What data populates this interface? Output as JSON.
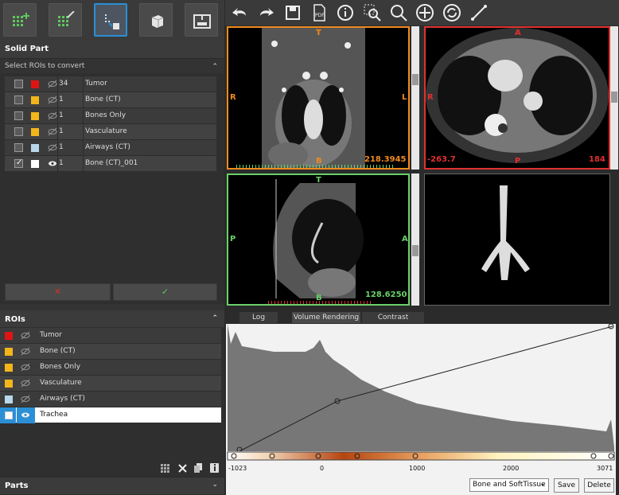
{
  "solid_part": {
    "title": "Solid Part",
    "subtitle": "Select ROIs to convert",
    "rows": [
      {
        "count": "34",
        "name": "Tumor",
        "color": "#e01414",
        "checked": false,
        "visible": false
      },
      {
        "count": "1",
        "name": "Bone (CT)",
        "color": "#f2b61b",
        "checked": false,
        "visible": false
      },
      {
        "count": "1",
        "name": "Bones Only",
        "color": "#f2b61b",
        "checked": false,
        "visible": false
      },
      {
        "count": "1",
        "name": "Vasculature",
        "color": "#f2b61b",
        "checked": false,
        "visible": false
      },
      {
        "count": "1",
        "name": "Airways (CT)",
        "color": "#b8d8ea",
        "checked": false,
        "visible": false
      },
      {
        "count": "1",
        "name": "Bone (CT)_001",
        "color": "#ffffff",
        "checked": true,
        "visible": true
      }
    ],
    "cancel_label": "✕",
    "ok_label": "✓"
  },
  "rois": {
    "title": "ROIs",
    "items": [
      {
        "name": "Tumor",
        "color": "#e01414"
      },
      {
        "name": "Bone (CT)",
        "color": "#f2b61b"
      },
      {
        "name": "Bones Only",
        "color": "#f2b61b"
      },
      {
        "name": "Vasculature",
        "color": "#f2b61b"
      },
      {
        "name": "Airways (CT)",
        "color": "#b8d8ea"
      },
      {
        "name": "Trachea",
        "color": "#ffffff",
        "selected": true
      }
    ]
  },
  "parts": {
    "title": "Parts"
  },
  "views": {
    "coronal": {
      "top": "T",
      "left": "R",
      "right": "L",
      "bottom": "B",
      "value": "218.3945"
    },
    "axial": {
      "top": "A",
      "left": "R",
      "value_left": "-263.7",
      "bottom": "P",
      "value_right": "184"
    },
    "sagittal": {
      "top": "T",
      "left": "P",
      "right": "A",
      "bottom": "B",
      "value": "128.6250"
    }
  },
  "tabs": [
    "Log",
    "Volume Rendering",
    "Contrast"
  ],
  "histogram": {
    "axis_labels": [
      "-1023",
      "0",
      "1000",
      "2000",
      "3071"
    ],
    "preset": "Bone and SoftTissue",
    "save_label": "Save",
    "delete_label": "Delete"
  },
  "colors": {
    "accent": "#2b8fd6",
    "coronal": "#f08a1e",
    "axial": "#e03030",
    "sagittal": "#6ad06a"
  }
}
